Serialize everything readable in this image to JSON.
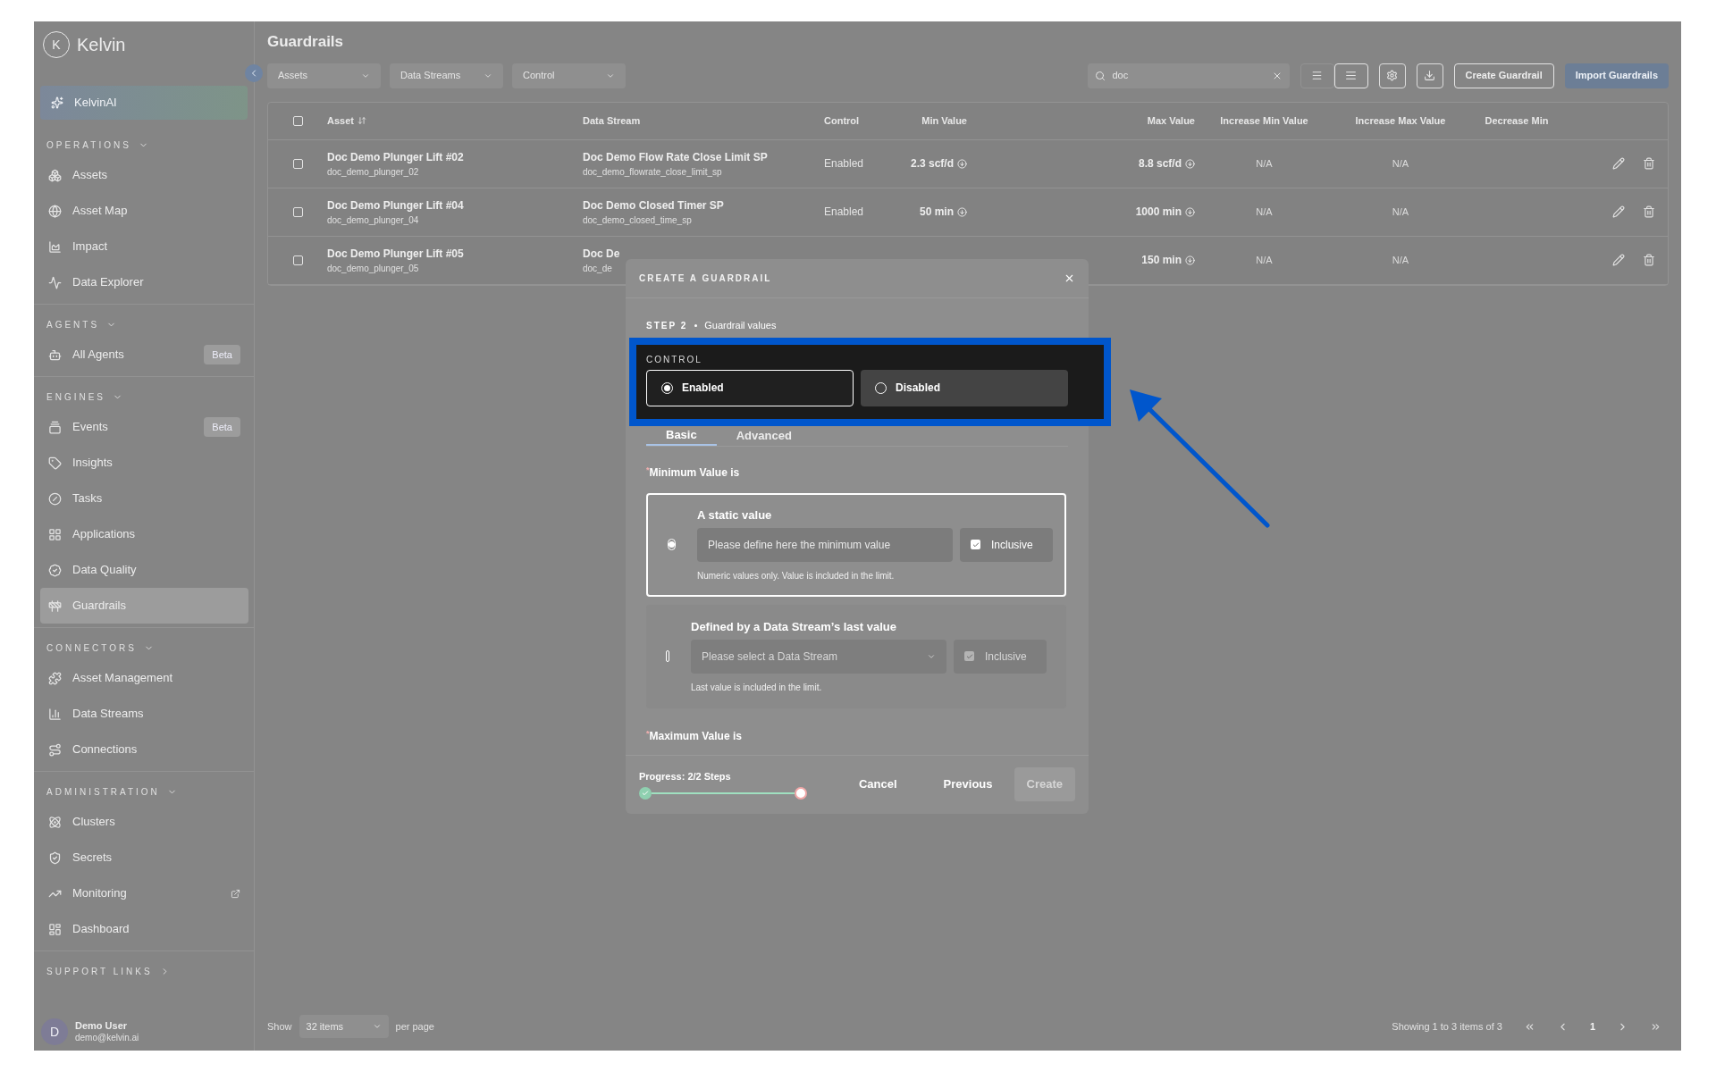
{
  "sidebar": {
    "logo_letter": "K",
    "brand": "Kelvin",
    "ai_item": "KelvinAI",
    "sections": [
      {
        "title": "OPERATIONS",
        "expanded": true,
        "items": [
          {
            "label": "Assets",
            "selected": false
          },
          {
            "label": "Asset Map",
            "selected": false
          },
          {
            "label": "Impact",
            "selected": false
          },
          {
            "label": "Data Explorer",
            "selected": false
          }
        ]
      },
      {
        "title": "AGENTS",
        "expanded": true,
        "items": [
          {
            "label": "All Agents",
            "selected": false,
            "badge": "Beta"
          }
        ]
      },
      {
        "title": "ENGINES",
        "expanded": true,
        "items": [
          {
            "label": "Events",
            "selected": false,
            "badge": "Beta"
          },
          {
            "label": "Insights",
            "selected": false
          },
          {
            "label": "Tasks",
            "selected": false
          },
          {
            "label": "Applications",
            "selected": false
          },
          {
            "label": "Data Quality",
            "selected": false
          },
          {
            "label": "Guardrails",
            "selected": true
          }
        ]
      },
      {
        "title": "CONNECTORS",
        "expanded": true,
        "items": [
          {
            "label": "Asset Management",
            "selected": false
          },
          {
            "label": "Data Streams",
            "selected": false
          },
          {
            "label": "Connections",
            "selected": false
          }
        ]
      },
      {
        "title": "ADMINISTRATION",
        "expanded": true,
        "items": [
          {
            "label": "Clusters",
            "selected": false
          },
          {
            "label": "Secrets",
            "selected": false
          },
          {
            "label": "Monitoring",
            "selected": false,
            "external": true
          },
          {
            "label": "Dashboard",
            "selected": false
          }
        ]
      },
      {
        "title": "SUPPORT LINKS",
        "expanded": false
      }
    ],
    "user": {
      "initial": "D",
      "name": "Demo User",
      "email": "demo@kelvin.ai"
    }
  },
  "page": {
    "title": "Guardrails",
    "filters": [
      "Assets",
      "Data Streams",
      "Control"
    ],
    "search": {
      "value": "doc"
    },
    "density": [
      {
        "selected": false
      },
      {
        "selected": true
      }
    ],
    "buttons": [
      {
        "label": "Create Guardrail",
        "kind": "outline"
      },
      {
        "label": "Import Guardrails",
        "kind": "primary"
      }
    ]
  },
  "table": {
    "select_all_checked": false,
    "columns": [
      "Asset",
      "Data Stream",
      "Control",
      "Min Value",
      "Max Value",
      "Increase Min Value",
      "Increase Max Value",
      "Decrease Min"
    ],
    "rows": [
      {
        "checked": false,
        "asset": "Doc Demo Plunger Lift #02",
        "asset_id": "doc_demo_plunger_02",
        "stream": "Doc Demo Flow Rate Close Limit SP",
        "stream_id": "doc_demo_flowrate_close_limit_sp",
        "control": "Enabled",
        "min": "2.3 scf/d",
        "max": "8.8 scf/d",
        "inc_min": "N/A",
        "inc_max": "N/A"
      },
      {
        "checked": false,
        "asset": "Doc Demo Plunger Lift #04",
        "asset_id": "doc_demo_plunger_04",
        "stream": "Doc Demo Closed Timer SP",
        "stream_id": "doc_demo_closed_time_sp",
        "control": "Enabled",
        "min": "50 min",
        "max": "1000 min",
        "inc_min": "N/A",
        "inc_max": "N/A"
      },
      {
        "checked": false,
        "asset": "Doc Demo Plunger Lift #05",
        "asset_id": "doc_demo_plunger_05",
        "stream": "Doc De",
        "stream_id": "doc_de",
        "max": "150 min",
        "inc_min": "N/A",
        "inc_max": "N/A"
      }
    ]
  },
  "pagination": {
    "show": "Show",
    "per_page_value": "32 items",
    "per_page": "per page",
    "summary": "Showing 1 to 3 items of 3",
    "page": "1"
  },
  "modal": {
    "title": "CREATE A GUARDRAIL",
    "step": "STEP 2",
    "step_name": "Guardrail values",
    "control_label": "CONTROL",
    "control_options": [
      {
        "label": "Enabled",
        "selected": true
      },
      {
        "label": "Disabled",
        "selected": false
      }
    ],
    "tabs": [
      {
        "label": "Basic",
        "selected": true
      },
      {
        "label": "Advanced",
        "selected": false
      }
    ],
    "min_label": "Minimum Value is",
    "required_mark": "*",
    "min_options": [
      {
        "kind": "input",
        "selected": true,
        "disabled": false,
        "title": "A static value",
        "placeholder": "Please define here the minimum value",
        "inclusive": "Inclusive",
        "inclusive_checked": true,
        "hint": "Numeric values only. Value is included in the limit."
      },
      {
        "kind": "select",
        "selected": false,
        "disabled": true,
        "title": "Defined by a Data Stream’s last value",
        "placeholder": "Please select a Data Stream",
        "inclusive": "Inclusive",
        "inclusive_checked": true,
        "hint": "Last value is included in the limit."
      }
    ],
    "max_label": "Maximum Value is",
    "progress": {
      "label": "Progress: 2/2 Steps",
      "level": 1
    },
    "buttons": [
      {
        "label": "Cancel",
        "disabled": false
      },
      {
        "label": "Previous",
        "disabled": false
      },
      {
        "label": "Create",
        "disabled": true
      }
    ]
  }
}
